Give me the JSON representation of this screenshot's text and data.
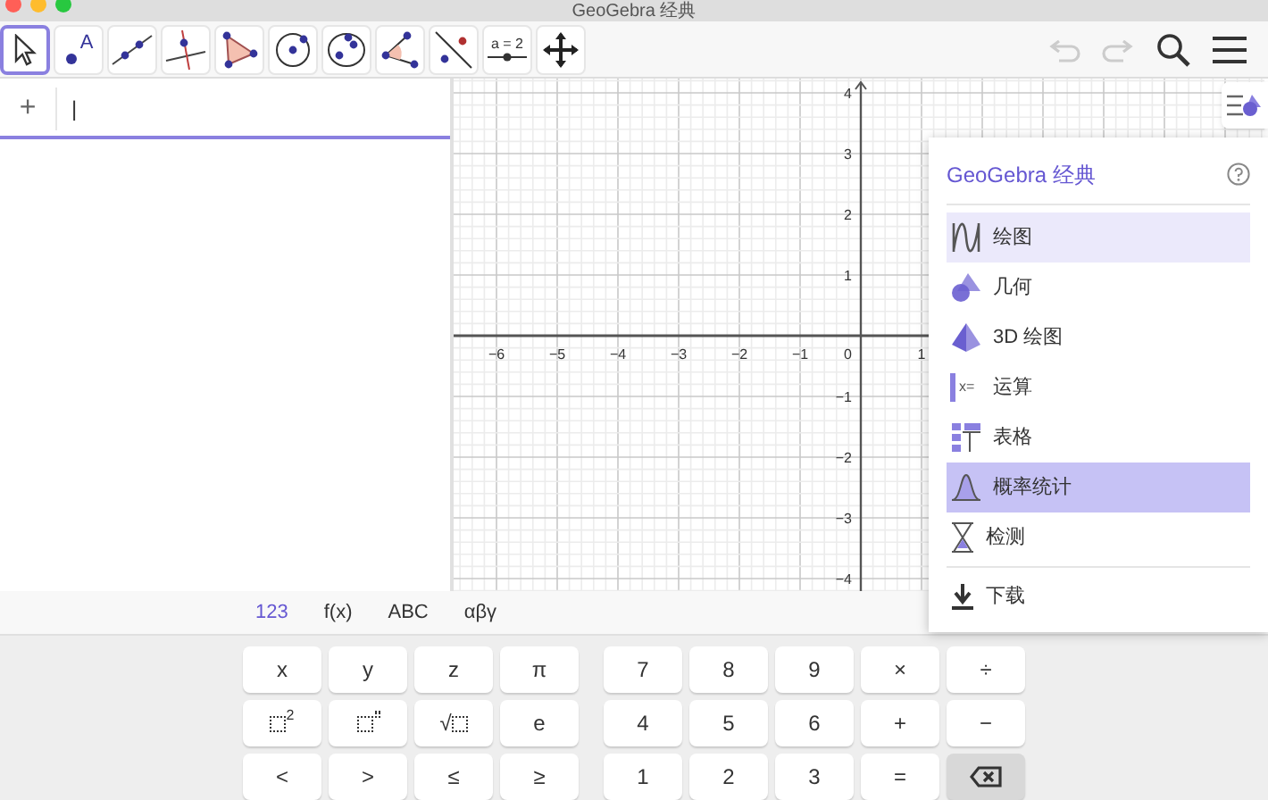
{
  "window": {
    "title": "GeoGebra 经典"
  },
  "toolbar": {
    "tools": [
      {
        "kind": "pointer",
        "selected": true
      },
      {
        "kind": "point",
        "label": "A",
        "selected": false
      },
      {
        "kind": "line",
        "selected": false
      },
      {
        "kind": "perpendicular",
        "selected": false
      },
      {
        "kind": "polygon",
        "selected": false
      },
      {
        "kind": "circle",
        "selected": false
      },
      {
        "kind": "conic",
        "selected": false
      },
      {
        "kind": "angle",
        "selected": false
      },
      {
        "kind": "reflect",
        "selected": false
      },
      {
        "kind": "slider",
        "label": "a = 2",
        "selected": false
      },
      {
        "kind": "move",
        "selected": false
      }
    ]
  },
  "algebra": {
    "add_symbol": "+",
    "input_value": "|"
  },
  "graphics": {
    "x_labels": [
      "−6",
      "−5",
      "−4",
      "−3",
      "−2",
      "−1",
      "1"
    ],
    "origin_label": "0",
    "y_labels": [
      "4",
      "3",
      "2",
      "1",
      "−1",
      "−2",
      "−3",
      "−4"
    ]
  },
  "app_menu": {
    "title": "GeoGebra 经典",
    "items": [
      {
        "kind": "graphing",
        "label": "绘图",
        "selected": true,
        "highlighted": false
      },
      {
        "kind": "geometry",
        "label": "几何",
        "selected": false,
        "highlighted": false
      },
      {
        "kind": "solid",
        "label": "3D 绘图",
        "selected": false,
        "highlighted": false
      },
      {
        "kind": "cas",
        "label": "运算",
        "icon_text": "x=",
        "selected": false,
        "highlighted": false
      },
      {
        "kind": "spreadsheet",
        "label": "表格",
        "selected": false,
        "highlighted": false
      },
      {
        "kind": "probability",
        "label": "概率统计",
        "selected": false,
        "highlighted": true
      },
      {
        "kind": "exam",
        "label": "检测",
        "selected": false,
        "highlighted": false
      },
      {
        "kind": "download",
        "label": "下载",
        "selected": false,
        "highlighted": false
      }
    ]
  },
  "keyboard": {
    "tabs": [
      {
        "label": "123",
        "selected": true
      },
      {
        "label": "f(x)",
        "selected": false
      },
      {
        "label": "ABC",
        "selected": false
      },
      {
        "label": "αβγ",
        "selected": false
      }
    ],
    "left_keys": [
      {
        "kind": "text",
        "label": "x"
      },
      {
        "kind": "text",
        "label": "y"
      },
      {
        "kind": "text",
        "label": "z"
      },
      {
        "kind": "text",
        "label": "π"
      },
      {
        "kind": "power",
        "label": "2"
      },
      {
        "kind": "power-empty"
      },
      {
        "kind": "sqrt",
        "label": "√"
      },
      {
        "kind": "text",
        "label": "e"
      },
      {
        "kind": "text",
        "label": "<"
      },
      {
        "kind": "text",
        "label": ">"
      },
      {
        "kind": "text",
        "label": "≤"
      },
      {
        "kind": "text",
        "label": "≥"
      }
    ],
    "right_keys": [
      {
        "kind": "text",
        "label": "7"
      },
      {
        "kind": "text",
        "label": "8"
      },
      {
        "kind": "text",
        "label": "9"
      },
      {
        "kind": "text",
        "label": "×"
      },
      {
        "kind": "text",
        "label": "÷"
      },
      {
        "kind": "text",
        "label": "4"
      },
      {
        "kind": "text",
        "label": "5"
      },
      {
        "kind": "text",
        "label": "6"
      },
      {
        "kind": "text",
        "label": "+"
      },
      {
        "kind": "text",
        "label": "−"
      },
      {
        "kind": "text",
        "label": "1"
      },
      {
        "kind": "text",
        "label": "2"
      },
      {
        "kind": "text",
        "label": "3"
      },
      {
        "kind": "text",
        "label": "="
      },
      {
        "kind": "backspace"
      }
    ]
  }
}
